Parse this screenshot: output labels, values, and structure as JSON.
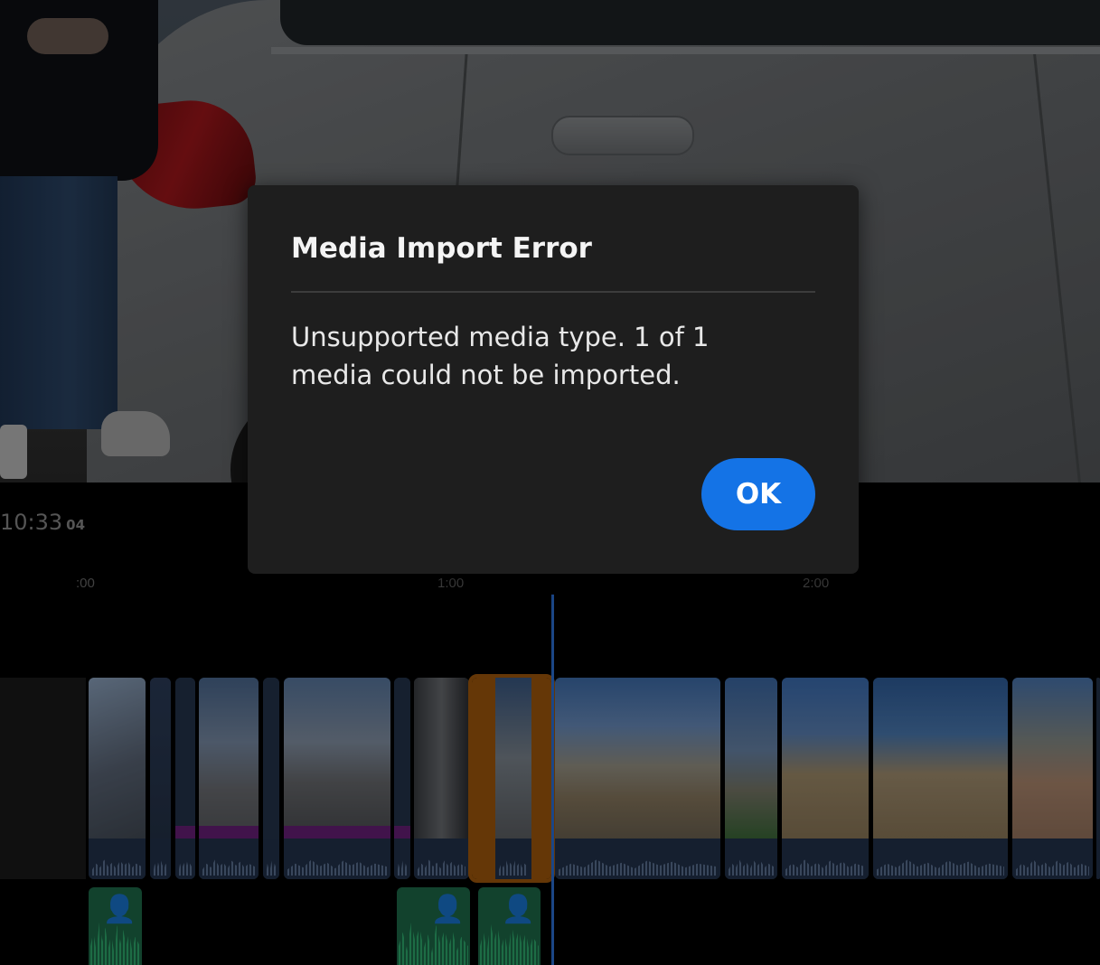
{
  "dialog": {
    "title": "Media Import Error",
    "message": "Unsupported media type. 1 of 1 media could not be imported.",
    "ok_label": "OK"
  },
  "timeline": {
    "timecode": "10:33",
    "timecode_frames": "04",
    "ticks": [
      ":00",
      "1:00",
      "2:00"
    ]
  },
  "colors": {
    "accent_blue": "#1473e6",
    "selected_clip": "#a35a0c",
    "voiceover_clip": "#1d6b4a",
    "playhead": "#2d72d9"
  },
  "icons": {
    "voiceover": "person-speaking-icon"
  }
}
